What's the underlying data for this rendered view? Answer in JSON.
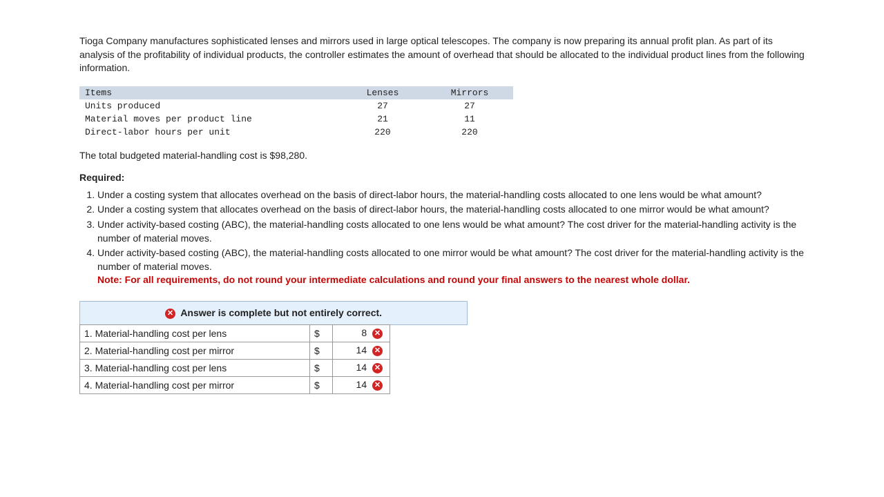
{
  "intro": "Tioga Company manufactures sophisticated lenses and mirrors used in large optical telescopes. The company is now preparing its annual profit plan. As part of its analysis of the profitability of individual products, the controller estimates the amount of overhead that should be allocated to the individual product lines from the following information.",
  "data_table": {
    "headers": {
      "items": "Items",
      "col1": "Lenses",
      "col2": "Mirrors"
    },
    "rows": [
      {
        "label": "Units produced",
        "v1": "27",
        "v2": "27"
      },
      {
        "label": "Material moves per product line",
        "v1": "21",
        "v2": "11"
      },
      {
        "label": "Direct-labor hours per unit",
        "v1": "220",
        "v2": "220"
      }
    ]
  },
  "budgeted": "The total budgeted material-handling cost is $98,280.",
  "required_label": "Required:",
  "questions": {
    "q1": "Under a costing system that allocates overhead on the basis of direct-labor hours, the material-handling costs allocated to one lens would be what amount?",
    "q2": "Under a costing system that allocates overhead on the basis of direct-labor hours, the material-handling costs allocated to one mirror would be what amount?",
    "q3": "Under activity-based costing (ABC), the material-handling costs allocated to one lens would be what amount? The cost driver for the material-handling activity is the number of material moves.",
    "q4": "Under activity-based costing (ABC), the material-handling costs allocated to one mirror would be what amount? The cost driver for the material-handling activity is the number of material moves.",
    "note": "Note: For all requirements, do not round your intermediate calculations and round your final answers to the nearest whole dollar."
  },
  "feedback": "Answer is complete but not entirely correct.",
  "answers": {
    "rows": [
      {
        "label": "1. Material-handling cost per lens",
        "currency": "$",
        "value": "8",
        "wrong": true
      },
      {
        "label": "2. Material-handling cost per mirror",
        "currency": "$",
        "value": "14",
        "wrong": true
      },
      {
        "label": "3. Material-handling cost per lens",
        "currency": "$",
        "value": "14",
        "wrong": true
      },
      {
        "label": "4. Material-handling cost per mirror",
        "currency": "$",
        "value": "14",
        "wrong": true
      }
    ]
  },
  "icons": {
    "x": "✕"
  }
}
